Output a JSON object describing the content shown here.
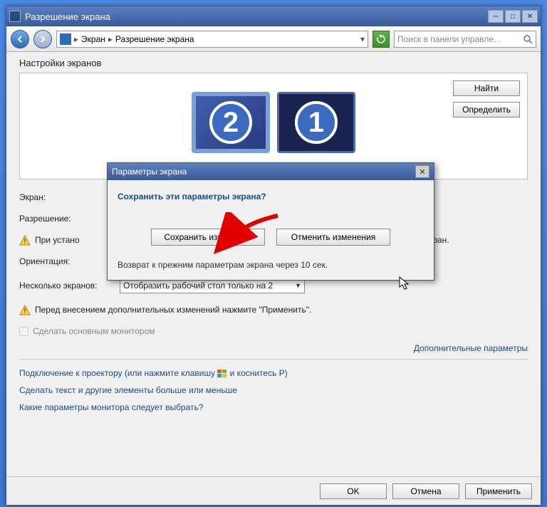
{
  "window": {
    "title": "Разрешение экрана"
  },
  "toolbar": {
    "breadcrumb": {
      "item1": "Экран",
      "item2": "Разрешение экрана"
    },
    "search_placeholder": "Поиск в панели управле…"
  },
  "main": {
    "section_title": "Настройки экранов",
    "find_button": "Найти",
    "identify_button": "Определить",
    "monitor1_number": "1",
    "monitor2_number": "2",
    "labels": {
      "screen": "Экран:",
      "resolution": "Разрешение:",
      "orientation": "Ориентация:",
      "multiple": "Несколько экранов:"
    },
    "warning1": "При устано",
    "warning1_suffix": "иться на экран.",
    "multiple_value": "Отобразить рабочий стол только на 2",
    "warning2": "Перед внесением дополнительных изменений нажмите \"Применить\".",
    "make_main": "Сделать основным монитором",
    "advanced": "Дополнительные параметры",
    "link1_pre": "Подключение к проектору (или нажмите клавишу ",
    "link1_post": " и коснитесь P)",
    "link2": "Сделать текст и другие элементы больше или меньше",
    "link3": "Какие параметры монитора следует выбрать?"
  },
  "bottom": {
    "ok": "OK",
    "cancel": "Отмена",
    "apply": "Применить"
  },
  "dialog": {
    "title": "Параметры экрана",
    "question": "Сохранить эти параметры экрана?",
    "save": "Сохранить изменения",
    "revert": "Отменить изменения",
    "status": "Возврат к прежним параметрам экрана через 10 сек."
  }
}
